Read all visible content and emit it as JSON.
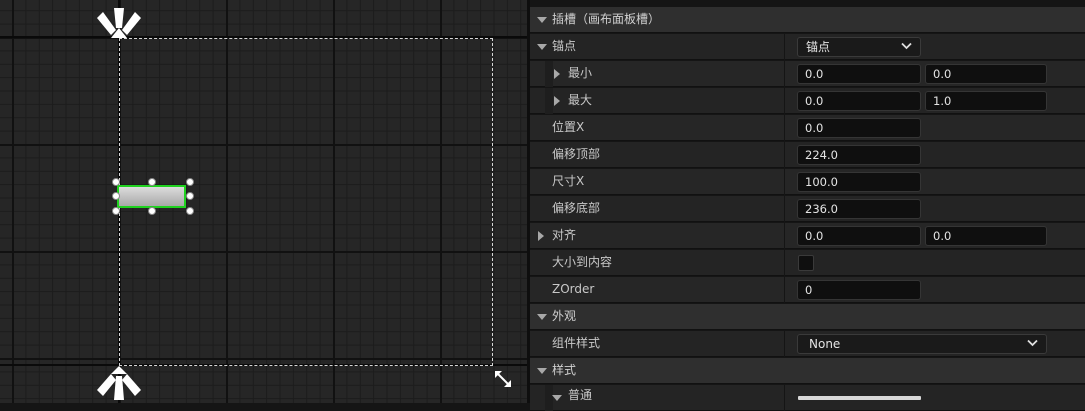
{
  "details": {
    "slot_category": "插槽（画布面板槽）",
    "anchors": {
      "label": "锚点",
      "value": "锚点"
    },
    "minimum": {
      "label": "最小",
      "x": "0.0",
      "y": "0.0"
    },
    "maximum": {
      "label": "最大",
      "x": "0.0",
      "y": "1.0"
    },
    "position_x": {
      "label": "位置X",
      "value": "0.0"
    },
    "offset_top": {
      "label": "偏移顶部",
      "value": "224.0"
    },
    "size_x": {
      "label": "尺寸X",
      "value": "100.0"
    },
    "offset_bottom": {
      "label": "偏移底部",
      "value": "236.0"
    },
    "alignment": {
      "label": "对齐",
      "x": "0.0",
      "y": "0.0"
    },
    "size_to_content": {
      "label": "大小到内容",
      "checked": false
    },
    "zorder": {
      "label": "ZOrder",
      "value": "0"
    },
    "appearance_category": "外观",
    "widget_style": {
      "label": "组件样式",
      "value": "None"
    },
    "style_category": "样式",
    "normal": {
      "label": "普通"
    }
  },
  "colors": {
    "selection": "#1fd21f",
    "canvas_bg": "#262626",
    "panel_bg": "#151515",
    "category_bg": "#2f2f2f"
  },
  "icons": [
    "anchor-top-icon",
    "anchor-bottom-icon",
    "resize-icon",
    "expand-arrow-icon",
    "collapse-arrow-icon",
    "chevron-down-icon"
  ]
}
